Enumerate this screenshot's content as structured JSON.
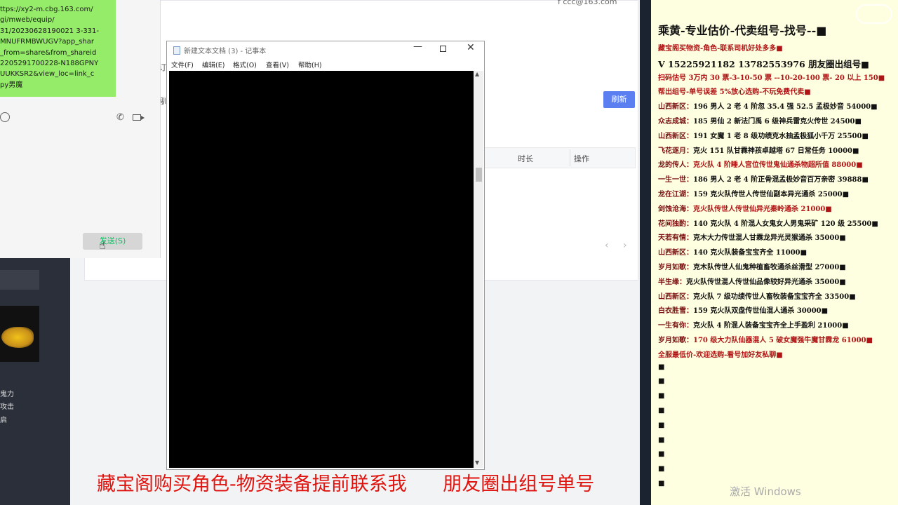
{
  "background_page": {
    "email_fragment": "f ccc@163.com",
    "refresh_label": "刷新",
    "columns": [
      "时长",
      "操作"
    ],
    "pager_prev": "‹",
    "pager_next": "›",
    "frag1": "订",
    "frag2": "驯"
  },
  "wechat": {
    "message_lines": [
      "ttps://xy2-m.cbg.163.com/",
      "gi/mweb/equip/",
      "31/20230628190021 3-331-",
      "MNUFRMBWUGV?app_shar",
      "_from=share&from_shareid",
      "2205291700228-N188GPNY",
      "UUKKSR2&view_loc=link_c",
      "py男魔"
    ],
    "send_label": "发送(S)"
  },
  "left_strip": {
    "lines": [
      "鬼力",
      "攻击",
      "启"
    ]
  },
  "notepad": {
    "title": "新建文本文档 (3) - 记事本",
    "menu": [
      "文件(F)",
      "编辑(E)",
      "格式(O)",
      "查看(V)",
      "帮助(H)"
    ],
    "minimize": "—",
    "close": "✕"
  },
  "right_panel": {
    "title": "乘黄-专业估价-代卖组号-找号--■",
    "lines": [
      {
        "prefix": "",
        "text": "藏宝阁买物资-角色-联系司机好处多多■",
        "red": true
      },
      {
        "prefix": "",
        "text": "V 15225921182    13782553976  朋友圈出组号■",
        "phone": true
      },
      {
        "prefix": "",
        "text": "扫码估号 3万内 30 票-3-10-50 票 --10-20-100 票- 20 以上 150■",
        "red": true
      },
      {
        "prefix": "",
        "text": "帮出组号-单号误差 5%放心选购-不玩免费代卖■",
        "red": true
      },
      {
        "prefix": "山西新区：",
        "text": "196 男人 2 老 4 阶忽 35.4 强 52.5 孟极妙音 54000■"
      },
      {
        "prefix": "众志成城：",
        "text": "185 男仙 2 新法门禹 6 级神兵雷克火传世 24500■"
      },
      {
        "prefix": "山西新区：",
        "text": "191 女魔 1 老 8 级功绩克水抽孟极狐小千万 25500■"
      },
      {
        "prefix": "飞花逐月：",
        "text": "克火 151 队甘霖神孩卓越塔 67 日常任务 10000■"
      },
      {
        "prefix": "龙的传人：",
        "text": "克火队 4 阶睡人宫位传世鬼仙通杀物超所值 88000■",
        "red": true
      },
      {
        "prefix": "一生一世：",
        "text": "186 男人 2 老 4 阶正骨混孟极妙音百万亲密 39888■"
      },
      {
        "prefix": "龙在江湖：",
        "text": "159 克火队传世人传世仙副本异光通杀 25000■"
      },
      {
        "prefix": "剑蚀沧海：",
        "text": "克火队传世人传世仙异光秦岭通杀 21000■",
        "red": true
      },
      {
        "prefix": "花间独酌：",
        "text": "140 克火队 4 阶混人女鬼女人男鬼采矿 120 级 25500■"
      },
      {
        "prefix": "天若有情：",
        "text": "克木大力传世混人甘霖龙异光灵猴通杀 35000■"
      },
      {
        "prefix": "山西新区：",
        "text": "140 克火队装备宝宝齐全 11000■"
      },
      {
        "prefix": "岁月如歌：",
        "text": "克木队传世人仙鬼种植畜牧通杀丝滑型 27000■"
      },
      {
        "prefix": "半生缘：",
        "text": "克火队传世混人传世仙品像较好异光通杀 35000■"
      },
      {
        "prefix": "山西新区：",
        "text": "克火队 7 级功绩传世人畜牧装备宝宝齐全 33500■"
      },
      {
        "prefix": "白衣胜雪：",
        "text": "159 克火队双盘传世仙混人通杀 30000■"
      },
      {
        "prefix": "一生有你：",
        "text": "克火队 4 阶混人装备宝宝齐全上手盈利 21000■"
      },
      {
        "prefix": "岁月如歌：",
        "text": "170 级大力队仙器混人 5 破女魔强牛魔甘霖龙 61000■",
        "red": true
      },
      {
        "prefix": "",
        "text": "全服最低价-欢迎选购-看号加好友私聊■",
        "red": true
      },
      {
        "prefix": "",
        "text": "■"
      },
      {
        "prefix": "",
        "text": "■"
      },
      {
        "prefix": "",
        "text": "■"
      },
      {
        "prefix": "",
        "text": "■"
      },
      {
        "prefix": "",
        "text": "■"
      },
      {
        "prefix": "",
        "text": "■"
      },
      {
        "prefix": "",
        "text": "■"
      },
      {
        "prefix": "",
        "text": "■"
      },
      {
        "prefix": "",
        "text": "■"
      }
    ]
  },
  "banner": {
    "text": "藏宝阁购买角色-物资装备提前联系我      朋友圈出组号单号"
  },
  "watermark": {
    "activate": "激活 Windows"
  }
}
